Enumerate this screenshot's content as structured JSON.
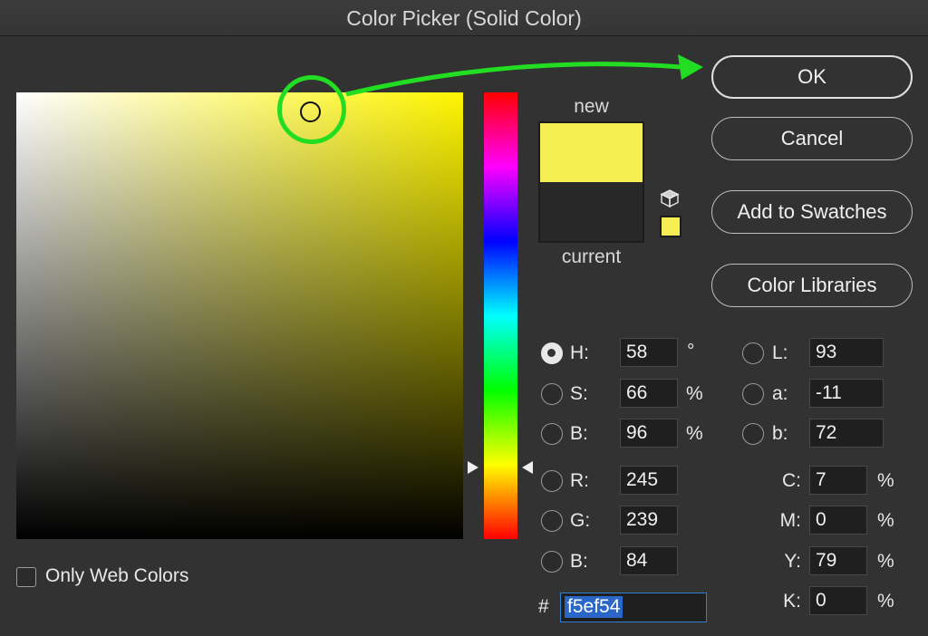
{
  "window": {
    "title": "Color Picker (Solid Color)"
  },
  "buttons": {
    "ok": "OK",
    "cancel": "Cancel",
    "add_to_swatches": "Add to Swatches",
    "color_libraries": "Color Libraries"
  },
  "preview": {
    "new_label": "new",
    "current_label": "current",
    "new_color": "#f5ef54",
    "current_color": "#282828"
  },
  "hsb": {
    "h": {
      "label": "H:",
      "value": "58",
      "unit": "°",
      "selected": true
    },
    "s": {
      "label": "S:",
      "value": "66",
      "unit": "%"
    },
    "b": {
      "label": "B:",
      "value": "96",
      "unit": "%"
    }
  },
  "rgb": {
    "r": {
      "label": "R:",
      "value": "245"
    },
    "g": {
      "label": "G:",
      "value": "239"
    },
    "b": {
      "label": "B:",
      "value": "84"
    }
  },
  "lab": {
    "l": {
      "label": "L:",
      "value": "93"
    },
    "a": {
      "label": "a:",
      "value": "-11"
    },
    "b": {
      "label": "b:",
      "value": "72"
    }
  },
  "cmyk": {
    "c": {
      "label": "C:",
      "value": "7",
      "unit": "%"
    },
    "m": {
      "label": "M:",
      "value": "0",
      "unit": "%"
    },
    "y": {
      "label": "Y:",
      "value": "79",
      "unit": "%"
    },
    "k": {
      "label": "K:",
      "value": "0",
      "unit": "%"
    }
  },
  "hex": {
    "hash": "#",
    "value": "f5ef54"
  },
  "options": {
    "only_web_colors": "Only Web Colors",
    "only_web_colors_checked": false
  },
  "colors": {
    "annotation": "#22dd22",
    "hue_at_slider": "#fff500"
  },
  "icons": {
    "gamut": "cube-icon"
  }
}
